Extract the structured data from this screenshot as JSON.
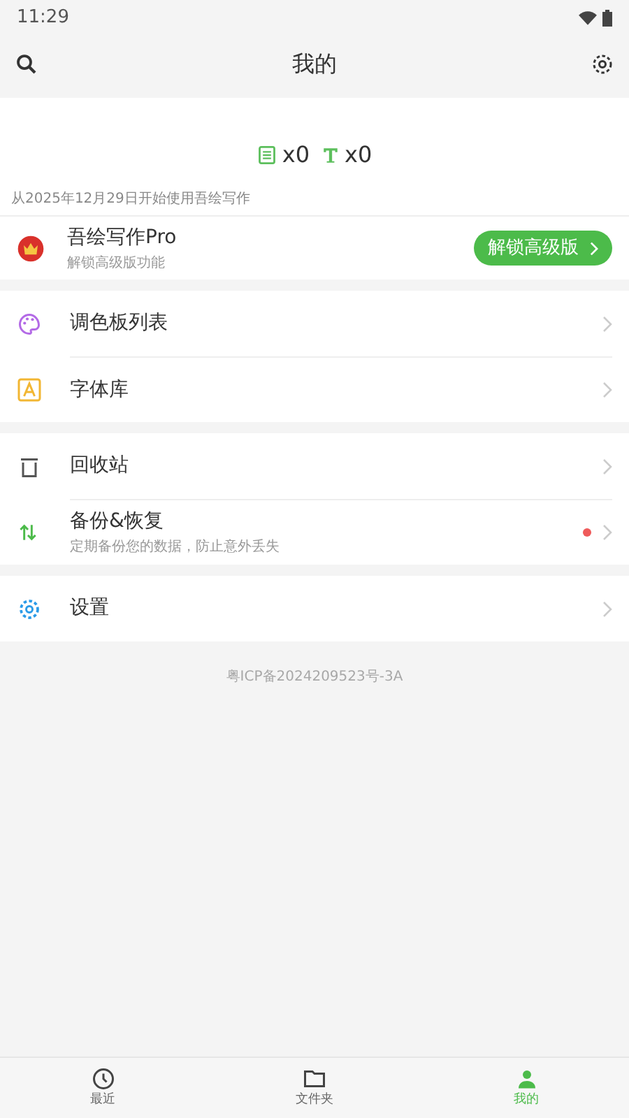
{
  "status_bar": {
    "time": "11:29"
  },
  "header": {
    "title": "我的"
  },
  "stats": [
    {
      "kind": "notes",
      "count": "x0"
    },
    {
      "kind": "text",
      "count": "x0"
    }
  ],
  "since": "从2025年12月29日开始使用吾绘写作",
  "pro": {
    "title": "吾绘写作Pro",
    "subtitle": "解锁高级版功能",
    "button": "解锁高级版"
  },
  "sections": [
    [
      {
        "kind": "palette",
        "label": "调色板列表"
      },
      {
        "kind": "font",
        "label": "字体库"
      }
    ],
    [
      {
        "kind": "trash",
        "label": "回收站"
      },
      {
        "kind": "sync",
        "label": "备份&恢复",
        "subtitle": "定期备份您的数据，防止意外丢失",
        "dot": true
      }
    ],
    [
      {
        "kind": "gear",
        "label": "设置"
      }
    ]
  ],
  "icp": "粤ICP备2024209523号-3A",
  "tabs": [
    {
      "kind": "clock",
      "label": "最近",
      "selected": false
    },
    {
      "kind": "folder",
      "label": "文件夹",
      "selected": false
    },
    {
      "kind": "person",
      "label": "我的",
      "selected": true
    }
  ]
}
